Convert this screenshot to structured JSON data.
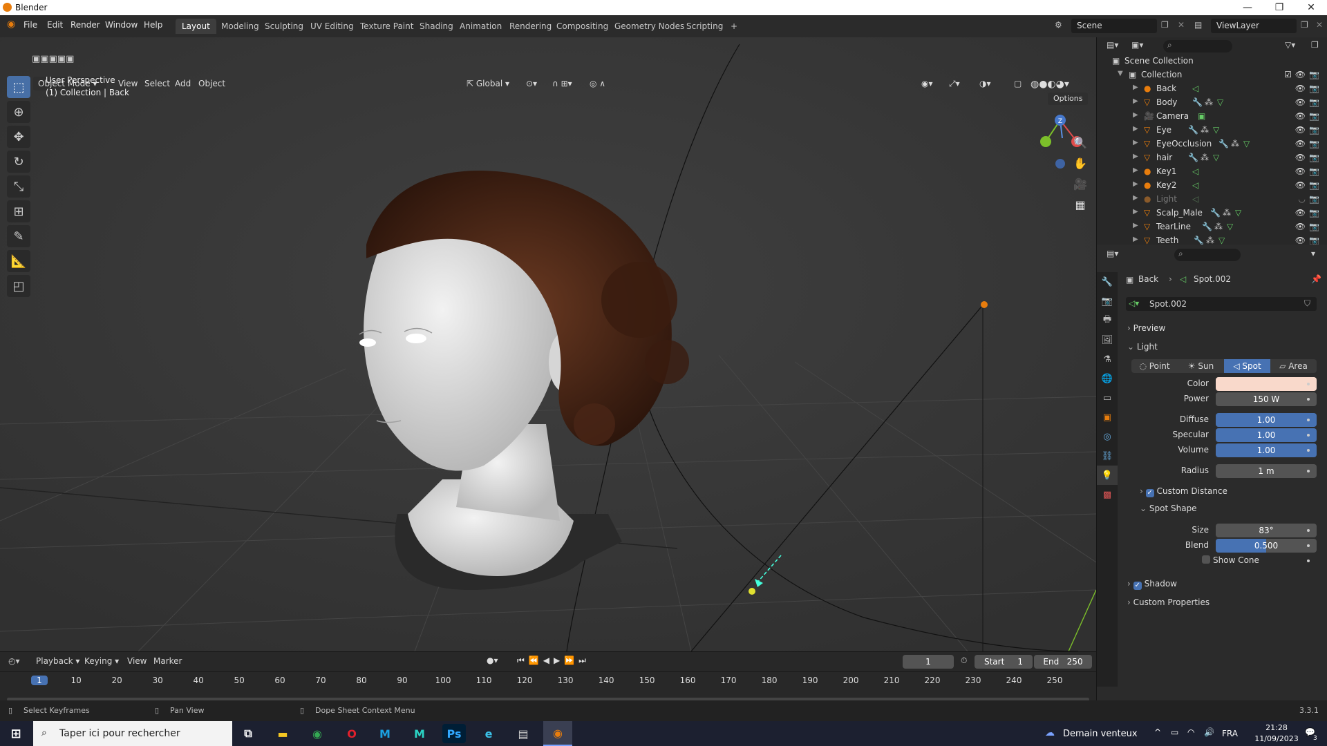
{
  "window": {
    "title": "Blender",
    "minimize": "—",
    "maximize": "❐",
    "close": "✕"
  },
  "menus": [
    "File",
    "Edit",
    "Render",
    "Window",
    "Help"
  ],
  "workspaces": [
    "Layout",
    "Modeling",
    "Sculpting",
    "UV Editing",
    "Texture Paint",
    "Shading",
    "Animation",
    "Rendering",
    "Compositing",
    "Geometry Nodes",
    "Scripting",
    "+"
  ],
  "scene": {
    "name": "Scene",
    "view_layer": "ViewLayer"
  },
  "viewport_header": {
    "mode": "Object Mode",
    "view": "View",
    "select": "Select",
    "add": "Add",
    "object": "Object",
    "orientation": "Global",
    "options": "Options"
  },
  "viewport": {
    "perspective": "User Perspective",
    "collection_info": "(1) Collection | Back"
  },
  "gizmo": {
    "z": "Z",
    "x": "X"
  },
  "outliner": {
    "scene_collection": "Scene Collection",
    "collection": "Collection",
    "items": [
      {
        "name": "Back",
        "type": "light"
      },
      {
        "name": "Body",
        "type": "mesh"
      },
      {
        "name": "Camera",
        "type": "camera"
      },
      {
        "name": "Eye",
        "type": "mesh"
      },
      {
        "name": "EyeOcclusion",
        "type": "mesh"
      },
      {
        "name": "hair",
        "type": "mesh"
      },
      {
        "name": "Key1",
        "type": "light"
      },
      {
        "name": "Key2",
        "type": "light"
      },
      {
        "name": "Light",
        "type": "light"
      },
      {
        "name": "Scalp_Male",
        "type": "mesh"
      },
      {
        "name": "TearLine",
        "type": "mesh"
      },
      {
        "name": "Teeth",
        "type": "mesh"
      }
    ]
  },
  "properties": {
    "breadcrumb_object": "Back",
    "breadcrumb_data": "Spot.002",
    "datablock": "Spot.002",
    "preview": "Preview",
    "light_section": "Light",
    "light_types": [
      "Point",
      "Sun",
      "Spot",
      "Area"
    ],
    "active_type": "Spot",
    "color_label": "Color",
    "color_value": "#f9d9cb",
    "power_label": "Power",
    "power": "150 W",
    "diffuse_label": "Diffuse",
    "diffuse": "1.00",
    "specular_label": "Specular",
    "specular": "1.00",
    "volume_label": "Volume",
    "volume": "1.00",
    "radius_label": "Radius",
    "radius": "1 m",
    "custom_distance": "Custom Distance",
    "spot_shape": "Spot Shape",
    "size_label": "Size",
    "size": "83°",
    "blend_label": "Blend",
    "blend": "0.500",
    "show_cone": "Show Cone",
    "shadow": "Shadow",
    "custom_properties": "Custom Properties"
  },
  "timeline": {
    "playback": "Playback",
    "keying": "Keying",
    "view": "View",
    "marker": "Marker",
    "current_frame": "1",
    "start_label": "Start",
    "start": "1",
    "end_label": "End",
    "end": "250",
    "ticks": [
      "1",
      "10",
      "20",
      "30",
      "40",
      "50",
      "60",
      "70",
      "80",
      "90",
      "100",
      "110",
      "120",
      "130",
      "140",
      "150",
      "160",
      "170",
      "180",
      "190",
      "200",
      "210",
      "220",
      "230",
      "240",
      "250"
    ]
  },
  "statusbar": {
    "select": "Select Keyframes",
    "pan": "Pan View",
    "context": "Dope Sheet Context Menu",
    "version": "3.3.1"
  },
  "taskbar": {
    "search": "Taper ici pour rechercher",
    "weather": "Demain venteux",
    "lang": "FRA",
    "time": "21:28",
    "date": "11/09/2023",
    "notif": "3"
  }
}
